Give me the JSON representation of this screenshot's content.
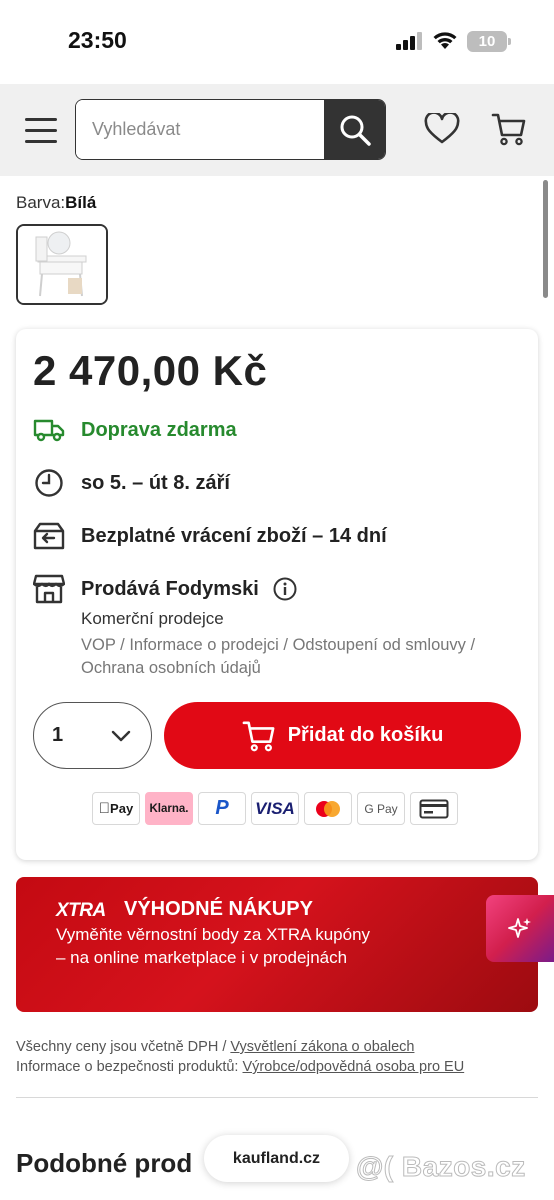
{
  "status_bar": {
    "time": "23:50",
    "battery": "10"
  },
  "header": {
    "search": {
      "placeholder": "Vyhledávat"
    },
    "icons": [
      "menu-icon",
      "search-icon",
      "heart-icon",
      "cart-icon"
    ]
  },
  "variant": {
    "label": "Barva:",
    "value": "Bílá"
  },
  "product": {
    "price": "2 470,00 Kč",
    "shipping": "Doprava zdarma",
    "delivery": "so 5. – út 8. září",
    "returns": "Bezplatné vrácení zboží – 14 dní",
    "seller": "Prodává Fodymski",
    "seller_type": "Komerční prodejce",
    "seller_links": [
      "VOP",
      "Informace o prodejci",
      "Odstoupení od smlouvy",
      "Ochrana osobních údajů"
    ],
    "link_separator": " / ",
    "quantity": "1",
    "add_to_cart": "Přidat do košíku",
    "payment_methods": [
      "Pay",
      "Klarna.",
      "P",
      "VISA",
      "mastercard",
      "G Pay",
      "card"
    ]
  },
  "xtra": {
    "logo": "XTRA",
    "title": "VÝHODNÉ NÁKUPY",
    "text": "Vyměňte věrnostní body za XTRA kupóny – na online marketplace i v prodejnách"
  },
  "notes": {
    "line1_prefix": "Všechny ceny jsou včetně DPH / ",
    "line1_link": "Vysvětlení zákona o obalech",
    "line2_prefix": "Informace o bezpečnosti produktů: ",
    "line2_link": "Výrobce/odpovědná osoba pro EU"
  },
  "similar_heading": "Podobné prod",
  "url_pill": "kaufland.cz",
  "watermark": "@( Bazos.cz",
  "colors": {
    "brand_red": "#e10915",
    "green": "#278a2e",
    "dark": "#333333",
    "klarna_pink": "#ffb3c7"
  }
}
